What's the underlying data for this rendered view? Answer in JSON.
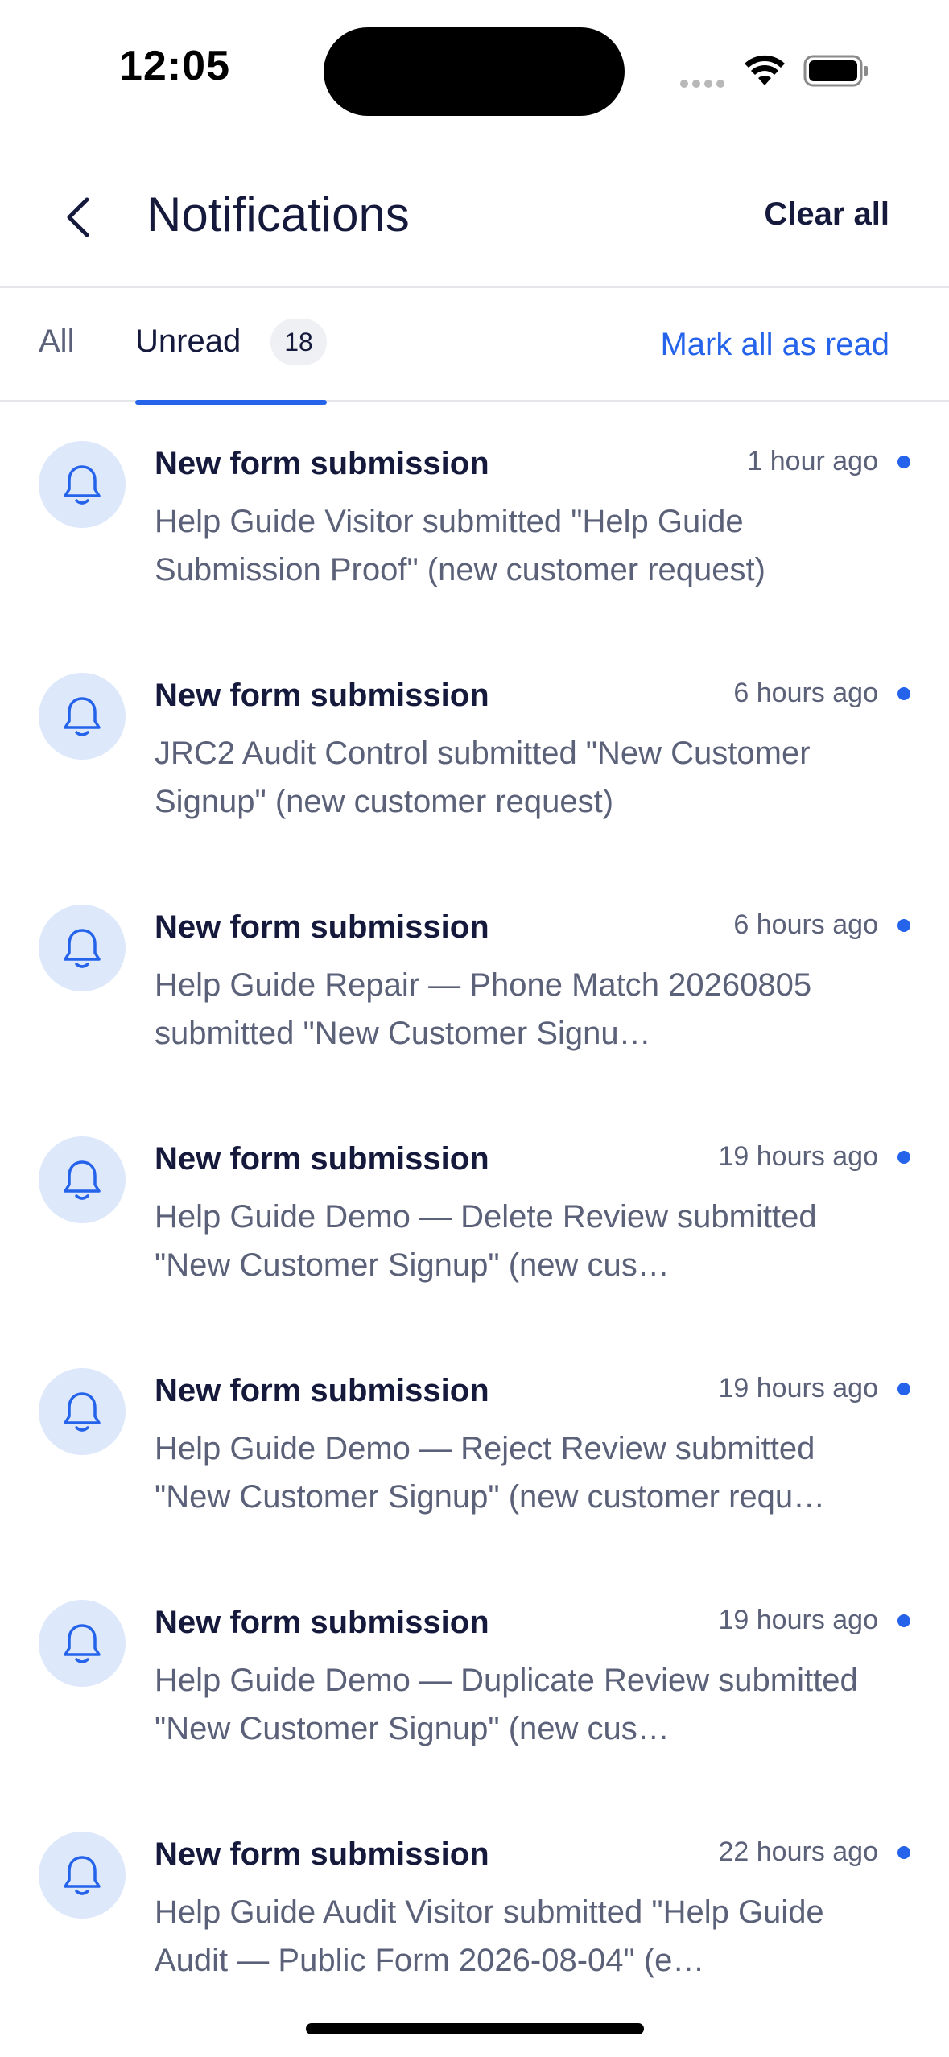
{
  "status_bar": {
    "time": "12:05"
  },
  "header": {
    "title": "Notifications",
    "back_icon": "chevron-left-icon",
    "clear_all_label": "Clear all"
  },
  "tabs": {
    "all_label": "All",
    "unread_label": "Unread",
    "unread_count": "18",
    "active": "Unread",
    "mark_all_label": "Mark all as read"
  },
  "colors": {
    "accent": "#2563eb",
    "icon_bg": "#dde8fb",
    "title_text": "#151a3c",
    "secondary_text": "#5b6178"
  },
  "notifications": [
    {
      "icon": "bell-icon",
      "title": "New form submission",
      "time": "1 hour ago",
      "body": "Help Guide Visitor submitted \"Help Guide Submission Proof\" (new customer request)",
      "unread": true
    },
    {
      "icon": "bell-icon",
      "title": "New form submission",
      "time": "6 hours ago",
      "body": "JRC2 Audit Control submitted \"New Customer Signup\" (new customer request)",
      "unread": true
    },
    {
      "icon": "bell-icon",
      "title": "New form submission",
      "time": "6 hours ago",
      "body": "Help Guide Repair — Phone Match 20260805 submitted \"New Customer Signu…",
      "unread": true
    },
    {
      "icon": "bell-icon",
      "title": "New form submission",
      "time": "19 hours ago",
      "body": "Help Guide Demo — Delete Review submitted \"New Customer Signup\" (new cus…",
      "unread": true
    },
    {
      "icon": "bell-icon",
      "title": "New form submission",
      "time": "19 hours ago",
      "body": "Help Guide Demo — Reject Review submitted \"New Customer Signup\" (new customer requ…",
      "unread": true
    },
    {
      "icon": "bell-icon",
      "title": "New form submission",
      "time": "19 hours ago",
      "body": "Help Guide Demo — Duplicate Review submitted \"New Customer Signup\" (new cus…",
      "unread": true
    },
    {
      "icon": "bell-icon",
      "title": "New form submission",
      "time": "22 hours ago",
      "body": "Help Guide Audit Visitor submitted \"Help Guide Audit — Public Form 2026-08-04\" (e…",
      "unread": true
    }
  ]
}
